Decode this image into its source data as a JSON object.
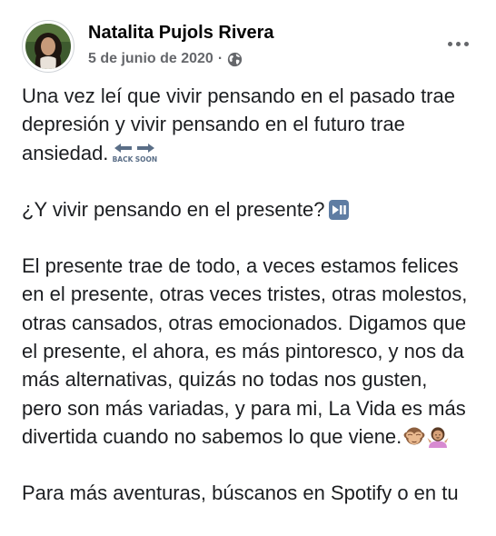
{
  "post": {
    "author": "Natalita Pujols Rivera",
    "date": "5 de junio de 2020",
    "separator": "·",
    "privacy_icon": "globe-icon",
    "more_icon": "more-horizontal-icon"
  },
  "content": {
    "p1": "Una vez leí que vivir pensando en el pasado trae\ndepresión y vivir pensando en el futuro trae\nansiedad.",
    "p1_emoji": "back-soon-arrows-icon",
    "p2": "¿Y vivir pensando en el presente?",
    "p2_emoji": "play-pause-icon",
    "p3": "El presente trae de todo, a veces estamos felices\nen el presente, otras veces tristes, otras molestos,\notras cansados, otras emocionados. Digamos que\nel presente, el ahora, es más pintoresco, y nos da\nmás alternativas, quizás no todas nos gusten,\npero son más variadas, y para mi, La Vida es más\ndivertida cuando no sabemos lo que viene.",
    "p3_emojis": [
      "see-no-evil-monkey-icon",
      "person-shrugging-icon"
    ],
    "p4": "Para más aventuras, búscanos en Spotify o en tu"
  },
  "colors": {
    "text": "#1c1e21",
    "secondary_text": "#65676b",
    "background": "#ffffff"
  }
}
